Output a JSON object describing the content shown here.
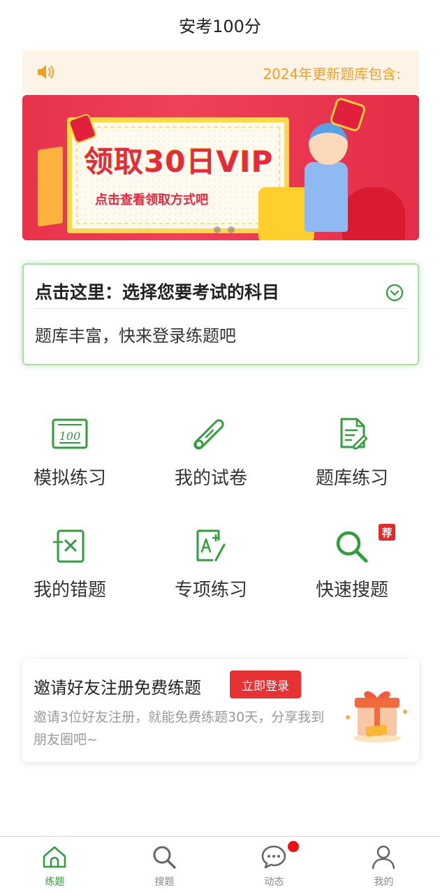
{
  "header": {
    "title": "安考100分"
  },
  "notice": {
    "text": "2024年更新题库包含:",
    "icon": "speaker-icon",
    "color": "#f2a021"
  },
  "banner": {
    "headline": "领取30日VIP",
    "subtitle": "点击查看领取方式吧",
    "page_indicator": {
      "count": 2
    }
  },
  "subject_selector": {
    "heading": "点击这里：选择您要考试的科目",
    "description": "题库丰富，快来登录练题吧",
    "icon": "chevron-down-circle-icon"
  },
  "features": [
    {
      "label": "模拟练习",
      "icon": "score-100-icon"
    },
    {
      "label": "我的试卷",
      "icon": "scroll-diploma-icon"
    },
    {
      "label": "题库练习",
      "icon": "document-edit-icon"
    },
    {
      "label": "我的错题",
      "icon": "wrong-answer-icon"
    },
    {
      "label": "专项练习",
      "icon": "grade-a-plus-icon"
    },
    {
      "label": "快速搜题",
      "icon": "search-icon",
      "badge": "荐"
    }
  ],
  "invite": {
    "title": "邀请好友注册免费练题",
    "button_label": "立即登录",
    "description": "邀请3位好友注册，就能免费练题30天，分享我到朋友圈吧~",
    "icon": "gift-box-icon"
  },
  "tabbar": {
    "items": [
      {
        "label": "练题",
        "icon": "home-icon",
        "active": true
      },
      {
        "label": "搜题",
        "icon": "search-icon",
        "active": false
      },
      {
        "label": "动态",
        "icon": "chat-bubble-icon",
        "active": false,
        "notification": true
      },
      {
        "label": "我的",
        "icon": "user-icon",
        "active": false
      }
    ]
  },
  "colors": {
    "accent": "#2e9f3a",
    "alert": "#e63232",
    "notice_bg": "#fdf3e6"
  }
}
